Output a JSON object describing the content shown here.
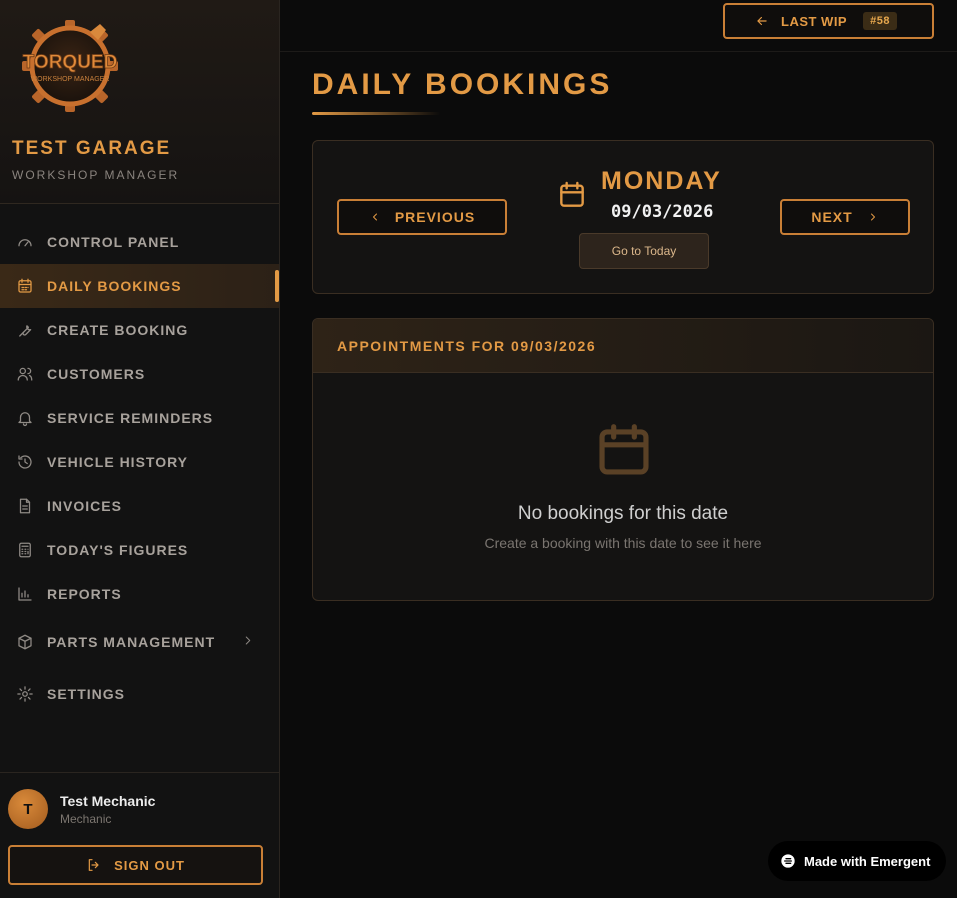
{
  "brand": {
    "logo_text": "TORQUED",
    "logo_subtext": "WORKSHOP MANAGER",
    "garage_name": "TEST GARAGE",
    "garage_subtitle": "WORKSHOP MANAGER",
    "accent_color": "#e39a45"
  },
  "sidebar": {
    "items": [
      {
        "label": "CONTROL PANEL",
        "icon": "gauge-icon"
      },
      {
        "label": "DAILY BOOKINGS",
        "icon": "calendar-icon",
        "active": true
      },
      {
        "label": "CREATE BOOKING",
        "icon": "wrench-icon"
      },
      {
        "label": "CUSTOMERS",
        "icon": "users-icon"
      },
      {
        "label": "SERVICE REMINDERS",
        "icon": "bell-icon"
      },
      {
        "label": "VEHICLE HISTORY",
        "icon": "history-icon"
      },
      {
        "label": "INVOICES",
        "icon": "document-icon"
      },
      {
        "label": "TODAY'S FIGURES",
        "icon": "calculator-icon"
      },
      {
        "label": "REPORTS",
        "icon": "bar-chart-icon"
      },
      {
        "label": "PARTS MANAGEMENT",
        "icon": "box-icon"
      },
      {
        "label": "SETTINGS",
        "icon": "gear-icon"
      }
    ]
  },
  "user": {
    "initial": "T",
    "name": "Test Mechanic",
    "role": "Mechanic",
    "sign_out_label": "SIGN OUT"
  },
  "topbar": {
    "last_wip_label": "LAST WIP",
    "last_wip_badge": "#58"
  },
  "main": {
    "title": "DAILY BOOKINGS",
    "previous_label": "PREVIOUS",
    "next_label": "NEXT",
    "day_name": "MONDAY",
    "date": "09/03/2026",
    "go_today_label": "Go to Today",
    "appointments_header": "APPOINTMENTS FOR 09/03/2026",
    "empty_title": "No bookings for this date",
    "empty_subtitle": "Create a booking with this date to see it here"
  },
  "footer_badge": {
    "label": "Made with Emergent"
  }
}
